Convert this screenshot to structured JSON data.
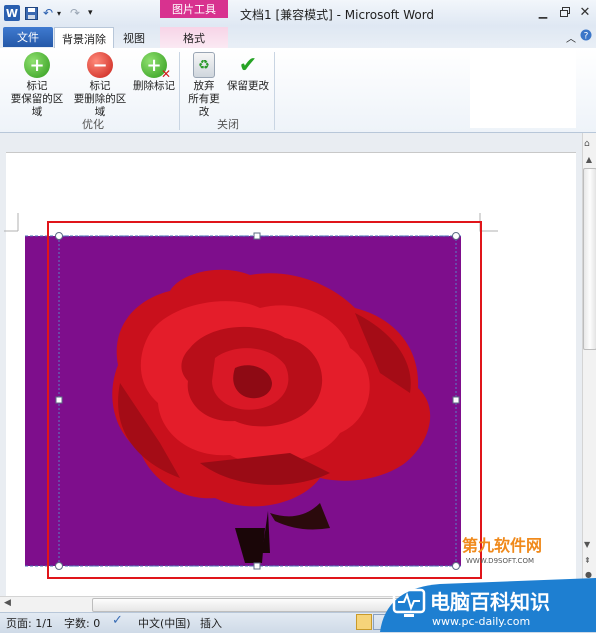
{
  "titlebar": {
    "context_tab": "图片工具",
    "window_title": "文档1 [兼容模式] - Microsoft Word",
    "word_icon_letter": "W"
  },
  "tabs": {
    "file": "文件",
    "background_removal": "背景消除",
    "view": "视图",
    "format": "格式"
  },
  "ribbon": {
    "mark_keep_line1": "标记",
    "mark_keep_line2": "要保留的区域",
    "mark_remove_line1": "标记",
    "mark_remove_line2": "要删除的区域",
    "delete_mark": "删除标记",
    "discard_line1": "放弃",
    "discard_line2": "所有更改",
    "keep_changes": "保留更改",
    "group_refine": "优化",
    "group_close": "关闭"
  },
  "watermarks": {
    "site_cn": "第九软件网",
    "site_url": "WWW.D9SOFT.COM",
    "badge_title": "电脑百科知识",
    "badge_url": "www.pc-daily.com"
  },
  "statusbar": {
    "page": "页面: 1/1",
    "words": "字数: 0",
    "language": "中文(中国)",
    "mode": "插入"
  },
  "colors": {
    "background_removal_mask": "#7e0e8c",
    "highlight_box": "#e0151a",
    "rose": "#d4121c"
  }
}
